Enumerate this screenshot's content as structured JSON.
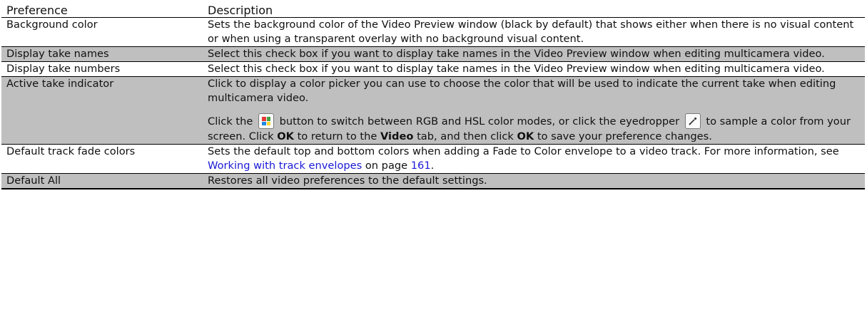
{
  "header": {
    "col1": "Preference",
    "col2": "Description"
  },
  "rows": {
    "bg": {
      "name": "Background color",
      "desc": "Sets the background color of the Video Preview window (black by default) that shows either when there is no visual content or when using a transparent overlay with no background visual content."
    },
    "names": {
      "name": "Display take names",
      "desc": "Select this check box if you want to display take names in the Video Preview window when editing multicamera video."
    },
    "numbers": {
      "name": "Display take numbers",
      "desc": "Select this check box if you want to display take names in the Video Preview window when editing multicamera video."
    },
    "active": {
      "name": "Active take indicator",
      "desc1": "Click to display a color picker you can use to choose the color that will be used to indicate the current take when editing multicamera video.",
      "p2_a": "Click the ",
      "p2_b": " button to switch between RGB and HSL color modes, or click the eyedropper ",
      "p2_c": " to sample a color from your screen. Click ",
      "ok1": "OK",
      "p2_d": " to return to the ",
      "video": "Video",
      "p2_e": " tab, and then click ",
      "ok2": "OK",
      "p2_f": " to save your preference changes."
    },
    "fade": {
      "name": "Default track fade colors",
      "desc_a": "Sets the default top and bottom colors when adding a Fade to Color envelope to a video track. For more information, see ",
      "link1": "Working with track envelopes",
      "desc_b": " on page ",
      "link2": "161",
      "desc_c": "."
    },
    "all": {
      "name": "Default All",
      "desc": "Restores all video preferences to the default settings."
    }
  },
  "icons": {
    "color_mode": "rgb-hsl-toggle-icon",
    "eyedropper": "eyedropper-icon"
  },
  "colors": {
    "shade": "#bfbfbf",
    "link": "#1a1ad6"
  }
}
